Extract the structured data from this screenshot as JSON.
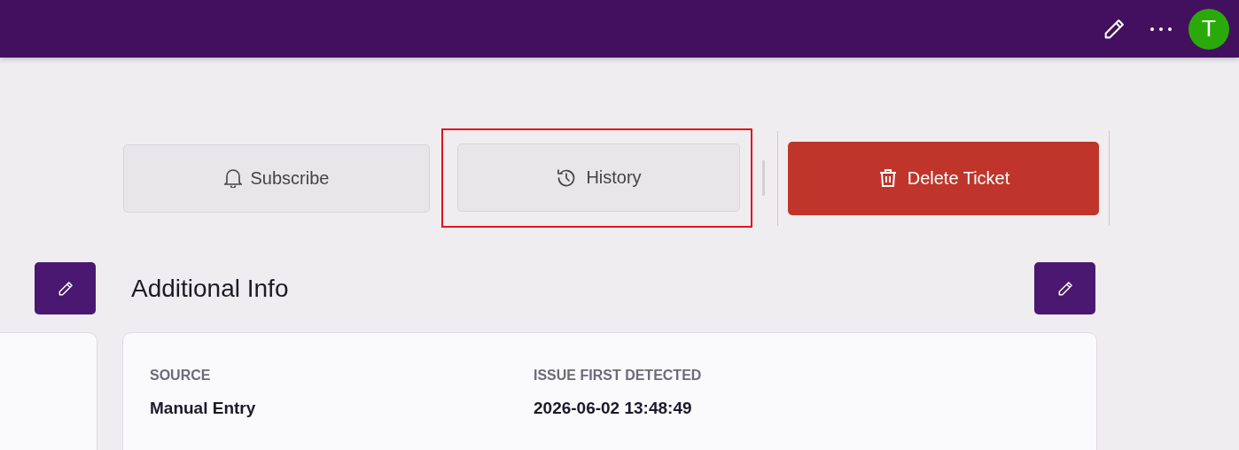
{
  "header": {
    "avatar_initial": "T"
  },
  "actions": [
    {
      "kind": "subscribe",
      "label": "Subscribe",
      "highlighted": false
    },
    {
      "kind": "history",
      "label": "History",
      "highlighted": true
    },
    {
      "kind": "delete",
      "label": "Delete Ticket",
      "highlighted": false
    }
  ],
  "section": {
    "title": "Additional Info",
    "fields": [
      {
        "label": "SOURCE",
        "value": "Manual Entry"
      },
      {
        "label": "ISSUE FIRST DETECTED",
        "value": "2026-06-02 13:48:49"
      }
    ]
  }
}
